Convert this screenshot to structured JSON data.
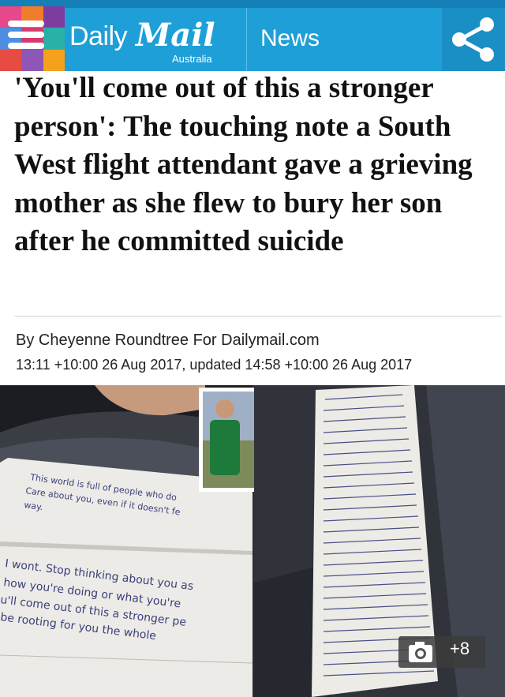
{
  "header": {
    "logo_daily": "Daily",
    "logo_mail": "Mail",
    "logo_sub": "Australia",
    "nav_label": "News",
    "menu_icon": "hamburger-menu-icon",
    "share_icon": "share-icon",
    "colors": {
      "bar": "#1e9fd8",
      "mosaic": [
        "#e6488a",
        "#f07d2c",
        "#7d3d9e",
        "#4d8ee0",
        "#d63b6e",
        "#2ab1a7",
        "#e64c43",
        "#8e57b6",
        "#f4a21d"
      ]
    }
  },
  "article": {
    "headline": "'You'll come out of this a stronger person': The touching note a South West flight attendant gave a grieving mother as she flew to bury her son after he committed suicide",
    "byline": "By Cheyenne Roundtree For Dailymail.com",
    "dateline": "13:11 +10:00 26 Aug 2017, updated 14:58 +10:00 26 Aug 2017"
  },
  "photo": {
    "note_left_lines": [
      "This world is full of people who do",
      "Care about you, even if it doesn't fe",
      "way."
    ],
    "note_left_lines_2": [
      "I wont. Stop thinking about you as",
      "how you're doing or what you're",
      "u'll come out of this a stronger pe",
      "be rooting for you the whole"
    ],
    "camera_icon": "camera-icon",
    "gallery_count": "+8"
  }
}
